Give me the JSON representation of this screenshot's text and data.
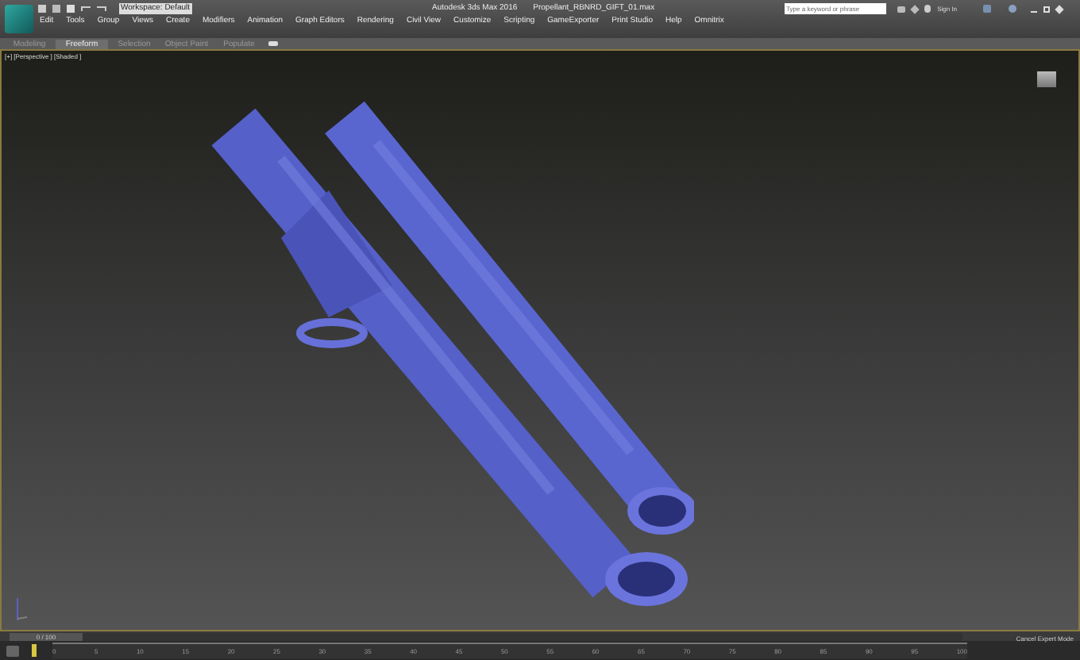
{
  "title_bar": {
    "workspace": "Workspace: Default",
    "app_title": "Autodesk 3ds Max 2016",
    "file_name": "Propellant_RBNRD_GIFT_01.max",
    "search": {
      "placeholder": "Type a keyword or phrase"
    },
    "sign_in": "Sign In"
  },
  "menu": [
    "Edit",
    "Tools",
    "Group",
    "Views",
    "Create",
    "Modifiers",
    "Animation",
    "Graph Editors",
    "Rendering",
    "Civil View",
    "Customize",
    "Scripting",
    "GameExporter",
    "Print Studio",
    "Help"
  ],
  "menu_extra": "Omnitrix",
  "ribbon_tabs": [
    {
      "label": "Modeling",
      "selected": false
    },
    {
      "label": "Freeform",
      "selected": true
    },
    {
      "label": "Selection",
      "selected": false
    },
    {
      "label": "Object Paint",
      "selected": false
    },
    {
      "label": "Populate",
      "selected": false
    }
  ],
  "viewport": {
    "label": "[+] [Perspective ] [Shaded ]"
  },
  "time_slider": {
    "frame": "0 / 100",
    "level": 0
  },
  "timeline": {
    "ticks": [
      "0",
      "5",
      "10",
      "15",
      "20",
      "25",
      "30",
      "35",
      "40",
      "45",
      "50",
      "55",
      "60",
      "65",
      "70",
      "75",
      "80",
      "85",
      "90",
      "95",
      "100"
    ]
  },
  "status": "Cancel Expert Mode"
}
